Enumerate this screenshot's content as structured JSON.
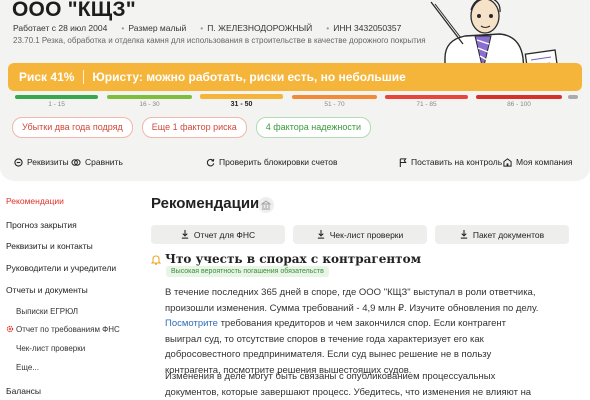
{
  "company": {
    "name": "ООО \"КЩЗ\"",
    "founded": "Работает с 28 июл 2004",
    "size": "Размер малый",
    "location": "П. ЖЕЛЕЗНОДОРОЖНЫЙ",
    "inn": "ИНН 3432050357",
    "okved": "23.70.1 Резка, обработка и отделка камня для использования в строительстве в качестве дорожного покрытия"
  },
  "risk": {
    "label": "Риск 41%",
    "message": "Юристу: можно работать, риски есть, но небольшие",
    "value_percent": 41,
    "scale": [
      {
        "range": "1 - 15",
        "color": "#37a84b"
      },
      {
        "range": "16 - 30",
        "color": "#7fbd3f"
      },
      {
        "range": "31 - 50",
        "color": "#f5b53b",
        "active": true
      },
      {
        "range": "51 - 70",
        "color": "#f28a36"
      },
      {
        "range": "71 - 85",
        "color": "#e8463a"
      },
      {
        "range": "86 - 100",
        "color": "#d6302a"
      }
    ]
  },
  "pills": [
    {
      "label": "Убытки два года подряд",
      "kind": "red"
    },
    {
      "label": "Еще 1 фактор риска",
      "kind": "red"
    },
    {
      "label": "4 фактора надежности",
      "kind": "green"
    }
  ],
  "actions": {
    "requisites": "Реквизиты",
    "compare": "Сравнить",
    "check_blocks": "Проверить блокировки счетов",
    "watch": "Поставить на контроль",
    "my_company": "Моя компания"
  },
  "sidebar": [
    {
      "label": "Рекомендации",
      "active": true
    },
    {
      "label": "Прогноз закрытия"
    },
    {
      "label": "Реквизиты и контакты"
    },
    {
      "label": "Руководители и учредители"
    },
    {
      "label": "Отчеты и документы"
    },
    {
      "label": "Выписки ЕГРЮЛ",
      "sub": true
    },
    {
      "label": "Отчет по требованиям ФНС",
      "sub": true,
      "icon": true
    },
    {
      "label": "Чек-лист проверки",
      "sub": true
    },
    {
      "label": "Еще...",
      "sub": true
    },
    {
      "label": "Балансы"
    }
  ],
  "main": {
    "heading": "Рекомендации",
    "buttons": [
      "Отчет для ФНС",
      "Чек-лист проверки",
      "Пакет документов"
    ],
    "section_title": "Что учесть в спорах с контрагентом",
    "badge": "Высокая вероятность погашения обязательств",
    "para1_a": "В течение последних 365 дней в споре, где ООО \"КЩЗ\" выступал в роли ответчика, произошли изменения. Сумма требований - 4,9 млн ₽. Изучите обновления по делу.",
    "para1_link": "Посмотрите",
    "para1_b": "требования кредиторов и чем закончился спор. Если контрагент выиграл суд, то отсутствие споров в течение года характеризует его как добросовестного предпринимателя. Если суд вынес решение не в пользу контрагента, посмотрите решения вышестоящих судов.",
    "para2": "Изменения в деле могут быть связаны с опубликованием процессуальных документов, которые завершают процесс. Убедитесь, что изменения не влияют на"
  },
  "colors": {
    "accent": "#f5b53b",
    "danger": "#e0322a",
    "link": "#2f6db6"
  }
}
